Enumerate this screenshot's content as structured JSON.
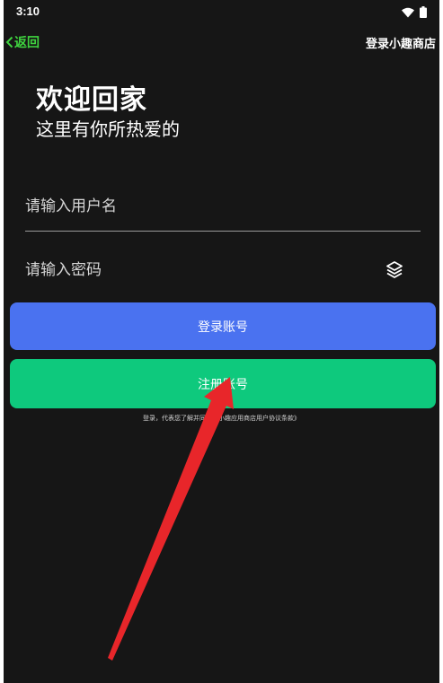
{
  "status_bar": {
    "time": "3:10"
  },
  "nav": {
    "back_label": "返回",
    "title": "登录小趣商店"
  },
  "welcome": {
    "title": "欢迎回家",
    "subtitle": "这里有你所热爱的"
  },
  "form": {
    "username_placeholder": "请输入用户名",
    "password_placeholder": "请输入密码"
  },
  "buttons": {
    "login_label": "登录账号",
    "register_label": "注册账号"
  },
  "agreement": {
    "text": "登录，代表您了解并同意《小趣应用商店用户协议条款》"
  },
  "colors": {
    "background": "#161616",
    "accent_green": "#3fd43f",
    "login_blue": "#4a72f0",
    "register_green": "#0ec97d",
    "annotation_red": "#e8262a"
  }
}
